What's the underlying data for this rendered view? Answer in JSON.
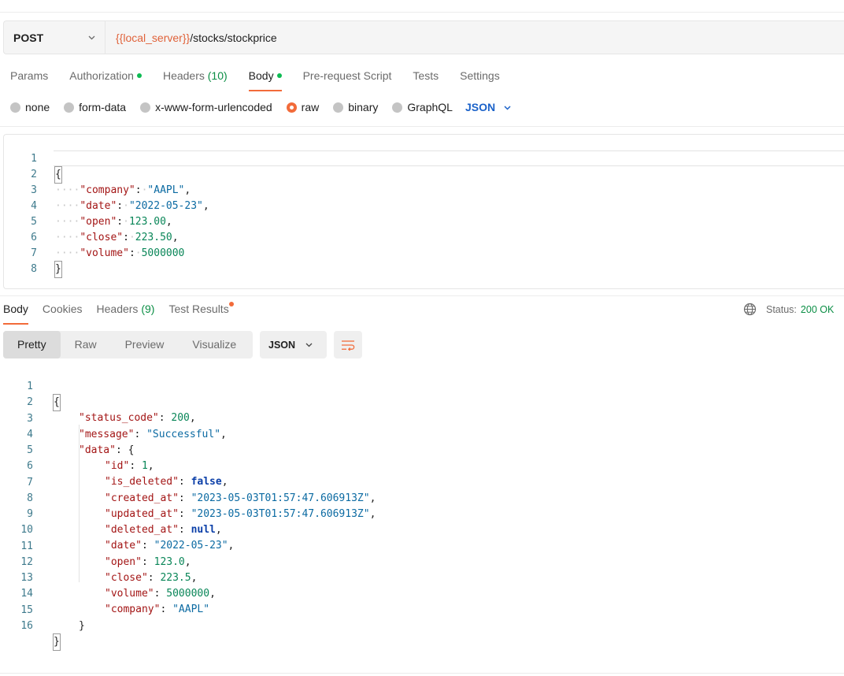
{
  "request": {
    "method": "POST",
    "url_variable": "{{local_server}}",
    "url_path": "/stocks/stockprice"
  },
  "request_tabs": [
    "Params",
    "Authorization",
    "Headers",
    "Body",
    "Pre-request Script",
    "Tests",
    "Settings"
  ],
  "headers_count": "(10)",
  "body_modes": [
    "none",
    "form-data",
    "x-www-form-urlencoded",
    "raw",
    "binary",
    "GraphQL"
  ],
  "body_format": "JSON",
  "request_line_numbers": [
    "1",
    "2",
    "3",
    "4",
    "5",
    "6",
    "7",
    "8"
  ],
  "request_body": {
    "brace_open": "{",
    "brace_close": "}",
    "company_key": "\"company\"",
    "company_val": "\"AAPL\"",
    "date_key": "\"date\"",
    "date_val": "\"2022-05-23\"",
    "open_key": "\"open\"",
    "open_val": "123.00",
    "close_key": "\"close\"",
    "close_val": "223.50",
    "volume_key": "\"volume\"",
    "volume_val": "5000000"
  },
  "response_tabs": [
    "Body",
    "Cookies",
    "Headers",
    "Test Results"
  ],
  "response_headers_count": "(9)",
  "status_label": "Status:",
  "status_value": "200 OK",
  "view_modes": [
    "Pretty",
    "Raw",
    "Preview",
    "Visualize"
  ],
  "response_format": "JSON",
  "response_line_numbers": [
    "1",
    "2",
    "3",
    "4",
    "5",
    "6",
    "7",
    "8",
    "9",
    "10",
    "11",
    "12",
    "13",
    "14",
    "15",
    "16"
  ],
  "response_body": {
    "status_code_key": "\"status_code\"",
    "status_code_val": "200",
    "message_key": "\"message\"",
    "message_val": "\"Successful\"",
    "data_key": "\"data\"",
    "id_key": "\"id\"",
    "id_val": "1",
    "is_deleted_key": "\"is_deleted\"",
    "is_deleted_val": "false",
    "created_at_key": "\"created_at\"",
    "created_at_val": "\"2023-05-03T01:57:47.606913Z\"",
    "updated_at_key": "\"updated_at\"",
    "updated_at_val": "\"2023-05-03T01:57:47.606913Z\"",
    "deleted_at_key": "\"deleted_at\"",
    "deleted_at_val": "null",
    "date_key": "\"date\"",
    "date_val": "\"2022-05-23\"",
    "open_key": "\"open\"",
    "open_val": "123.0",
    "close_key": "\"close\"",
    "close_val": "223.5",
    "volume_key": "\"volume\"",
    "volume_val": "5000000",
    "company_key": "\"company\"",
    "company_val": "\"AAPL\""
  },
  "colors": {
    "accent": "#f26b3a",
    "status_ok": "#0b8e45",
    "json_key": "#a31515",
    "json_string": "#0b6aa2",
    "json_number": "#098658"
  },
  "icons": [
    "chevron-down-icon",
    "globe-icon",
    "wrap-lines-icon"
  ]
}
